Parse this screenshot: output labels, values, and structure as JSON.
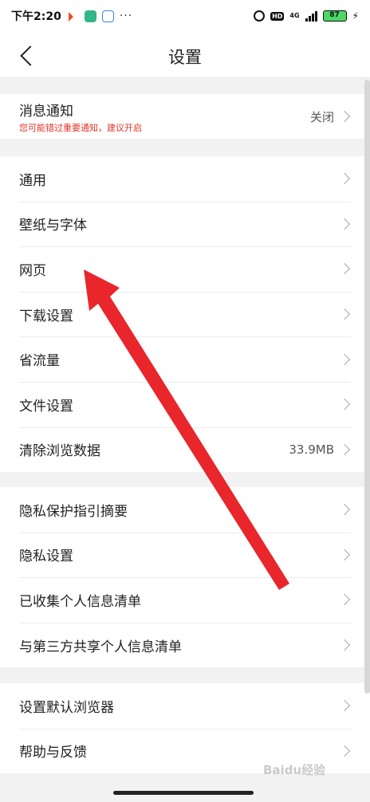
{
  "status_bar": {
    "time": "下午2:20",
    "dots": "···",
    "network": "4G",
    "hd": "HD",
    "battery": "87"
  },
  "header": {
    "title": "设置"
  },
  "notification": {
    "label": "消息通知",
    "subtitle": "您可能错过重要通知，建议开启",
    "value": "关闭"
  },
  "group_general": [
    {
      "label": "通用"
    },
    {
      "label": "壁纸与字体"
    },
    {
      "label": "网页"
    },
    {
      "label": "下载设置"
    },
    {
      "label": "省流量"
    },
    {
      "label": "文件设置"
    },
    {
      "label": "清除浏览数据",
      "value": "33.9MB"
    }
  ],
  "group_privacy": [
    {
      "label": "隐私保护指引摘要"
    },
    {
      "label": "隐私设置"
    },
    {
      "label": "已收集个人信息清单"
    },
    {
      "label": "与第三方共享个人信息清单"
    }
  ],
  "group_other": [
    {
      "label": "设置默认浏览器"
    },
    {
      "label": "帮助与反馈"
    }
  ],
  "watermark": "Baidu经验",
  "colors": {
    "annotation_arrow": "#e8262b",
    "warning_text": "#e2342a",
    "battery_fill": "#4cd964"
  }
}
